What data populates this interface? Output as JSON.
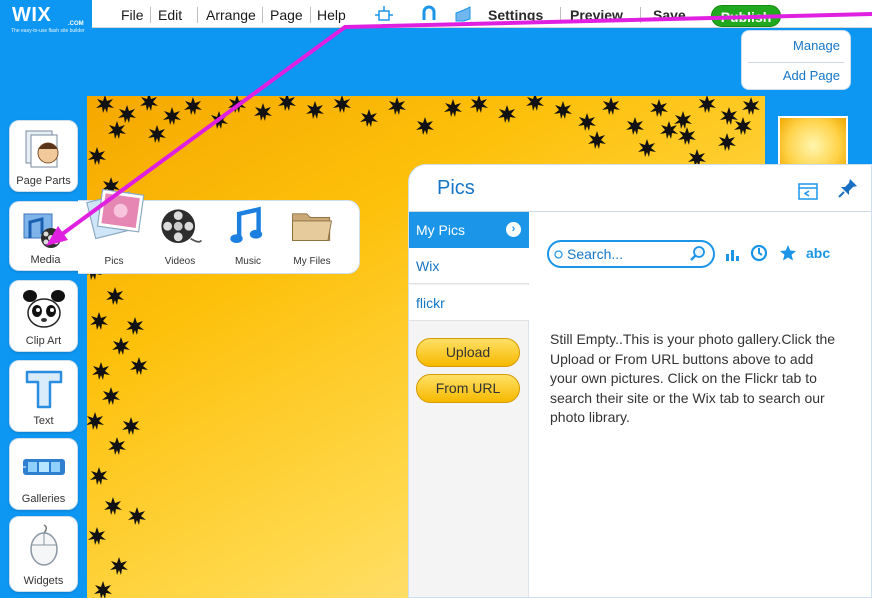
{
  "app": {
    "logo_text": "WIX",
    "logo_dotcom": ".COM",
    "logo_tagline": "The easy-to-use flash site builder"
  },
  "menu": {
    "items": [
      "File",
      "Edit",
      "Arrange",
      "Page",
      "Help"
    ],
    "settings": "Settings",
    "preview": "Preview",
    "save": "Save",
    "publish": "Publish"
  },
  "page_menu": {
    "manage": "Manage",
    "add_page": "Add Page"
  },
  "tools": [
    {
      "label": "Page Parts",
      "icon": "page-parts-icon"
    },
    {
      "label": "Media",
      "icon": "media-icon"
    },
    {
      "label": "Clip Art",
      "icon": "clip-art-icon"
    },
    {
      "label": "Text",
      "icon": "text-icon"
    },
    {
      "label": "Galleries",
      "icon": "galleries-icon"
    },
    {
      "label": "Widgets",
      "icon": "widgets-icon"
    }
  ],
  "media_flyout": [
    {
      "label": "Pics",
      "icon": "pics-icon"
    },
    {
      "label": "Videos",
      "icon": "videos-icon"
    },
    {
      "label": "Music",
      "icon": "music-icon"
    },
    {
      "label": "My Files",
      "icon": "folder-icon"
    }
  ],
  "pics_panel": {
    "title": "Pics",
    "tabs": [
      "My Pics",
      "Wix",
      "flickr"
    ],
    "active_tab": "My Pics",
    "upload_label": "Upload",
    "from_url_label": "From URL",
    "search_placeholder": "Search...",
    "sort_abc": "abc",
    "empty_message": "Still Empty..This is your photo gallery.Click the Upload or From URL buttons above to add your own pictures. Click on the Flickr tab to search their site or the Wix tab to search our photo library."
  },
  "colors": {
    "wix_blue": "#0d96f2",
    "publish_green": "#22a81e",
    "link_blue": "#1676c6",
    "gold_button": "#f6b900",
    "annotation_arrow": "#e020e0"
  }
}
